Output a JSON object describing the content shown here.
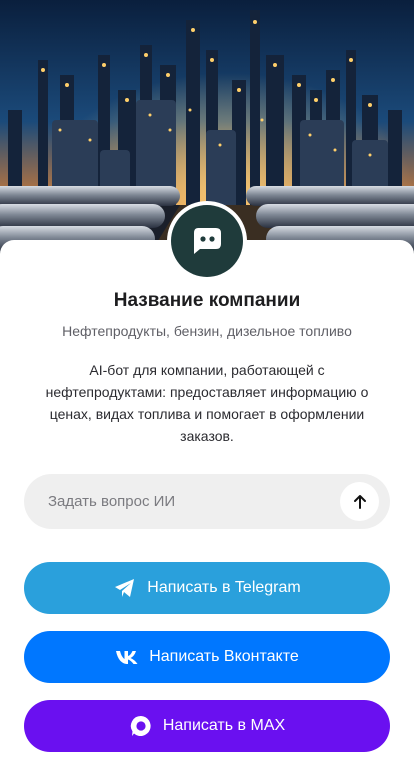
{
  "hero": {
    "image": "oil-refinery-night-photo"
  },
  "company": {
    "avatar_icon": "chat-bot-icon",
    "name": "Название компании",
    "subtitle": "Нефтепродукты, бензин, дизельное топливо",
    "description": "AI-бот для компании, работающей с нефтепродуктами: предоставляет информацию о ценах, видах топлива и помогает в оформлении заказов."
  },
  "ask": {
    "placeholder": "Задать вопрос ИИ",
    "value": "",
    "send_icon": "arrow-up-icon"
  },
  "buttons": {
    "telegram": {
      "label": "Написать в Telegram",
      "icon": "telegram-icon",
      "color": "#2aa0dc"
    },
    "vk": {
      "label": "Написать Вконтакте",
      "icon": "vk-icon",
      "color": "#0077ff"
    },
    "max": {
      "label": "Написать в MAX",
      "icon": "max-icon",
      "color": "#6a10f0"
    }
  },
  "colors": {
    "avatar_bg": "#1f3b3b",
    "input_bg": "#efefef",
    "title_text": "#1d1d1f"
  }
}
